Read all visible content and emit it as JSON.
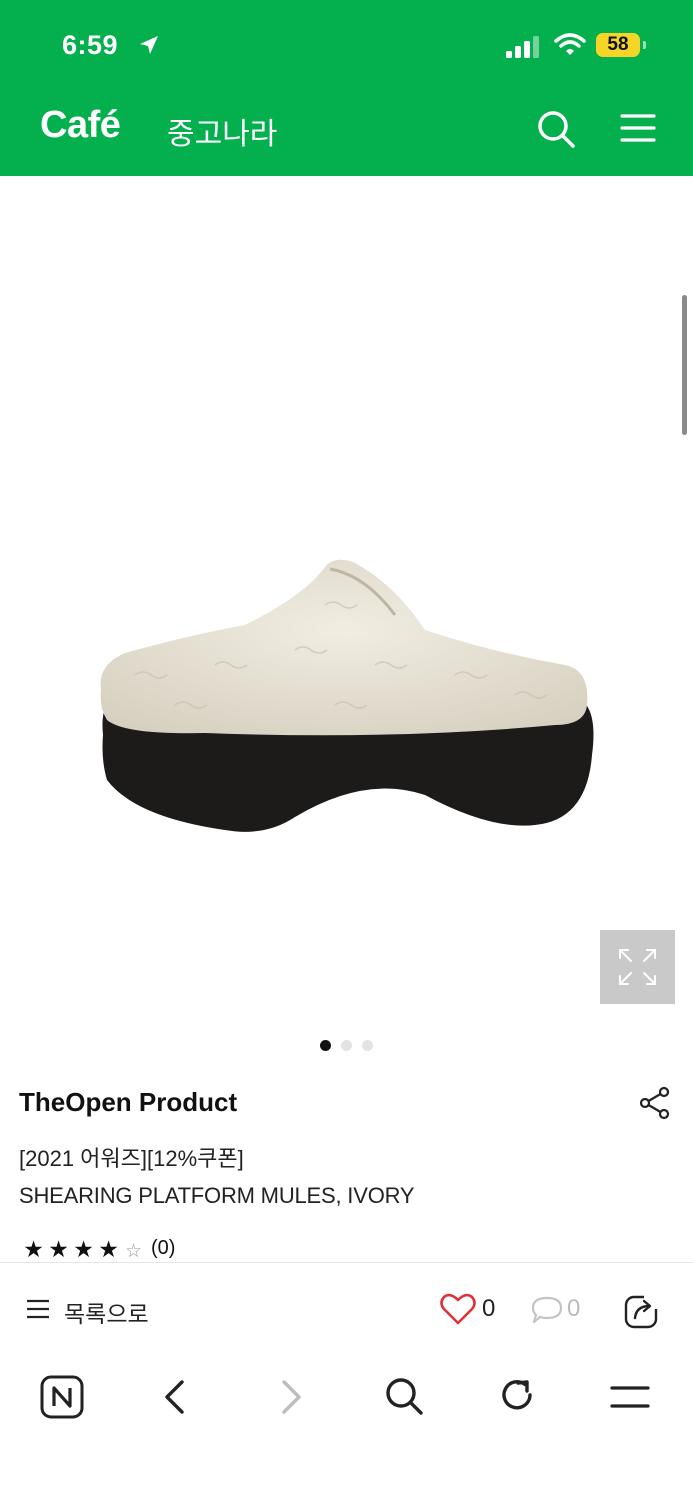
{
  "status_bar": {
    "time": "6:59",
    "battery": "58"
  },
  "header": {
    "brand": "Café",
    "cafe_name": "중고나라"
  },
  "product": {
    "store": "TheOpen Product",
    "promo": "[2021 어워즈][12%쿠폰]",
    "title": "SHEARING PLATFORM MULES, IVORY",
    "rating": 4,
    "rating_max": 5,
    "review_count": "(0)",
    "image_count": 3,
    "current_image": 1
  },
  "action_bar": {
    "list_label": "목록으로",
    "likes": "0",
    "comments": "0"
  },
  "icons": {
    "header": [
      "location-arrow-icon",
      "signal-icon",
      "wifi-icon",
      "battery-icon",
      "search-icon",
      "menu-icon"
    ],
    "bottom": [
      "naver-home-icon",
      "back-icon",
      "forward-icon",
      "search-icon",
      "refresh-icon",
      "menu-icon"
    ]
  },
  "colors": {
    "brand_green": "#03b04d",
    "heart_red": "#e0303a",
    "battery_yellow": "#f7d526"
  }
}
